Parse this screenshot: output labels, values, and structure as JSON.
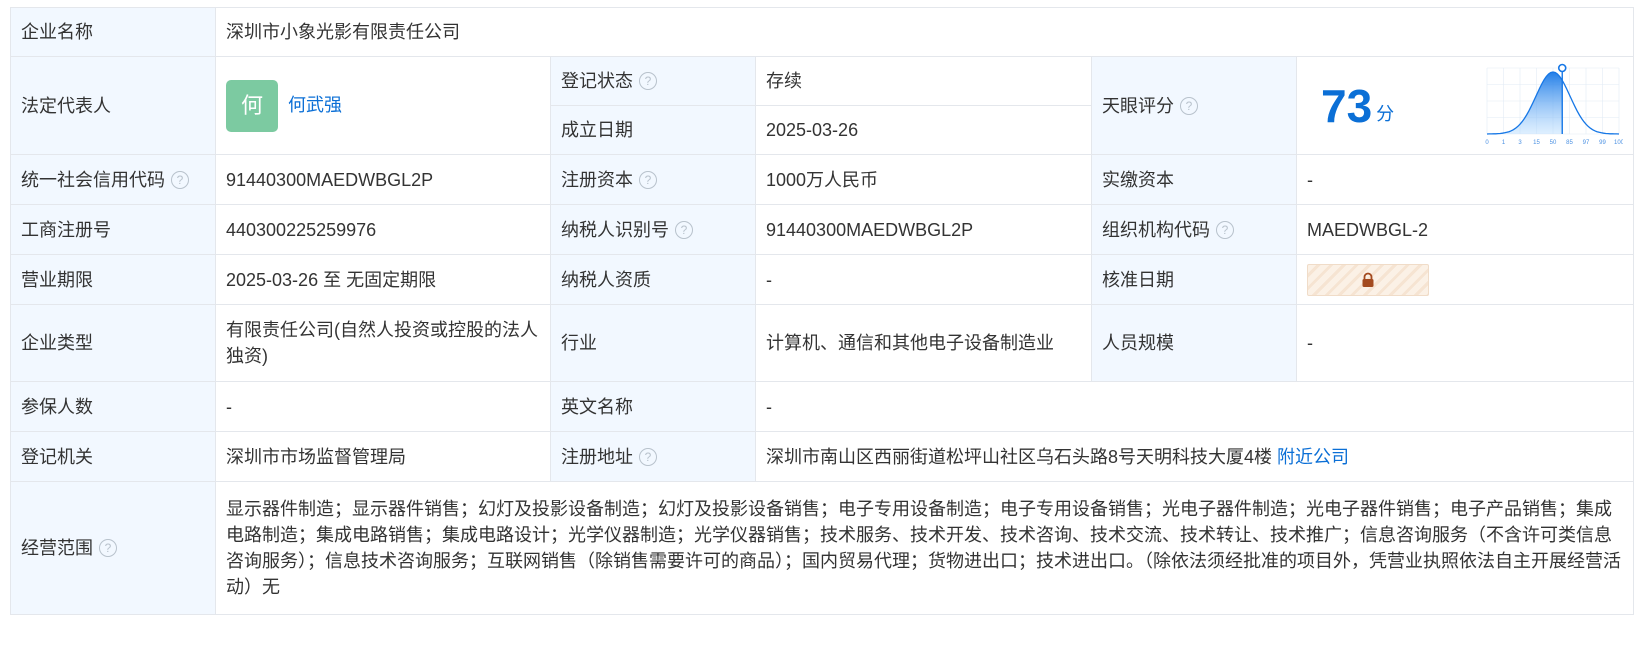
{
  "company_name": {
    "label": "企业名称",
    "value": "深圳市小象光影有限责任公司"
  },
  "legal_rep": {
    "label": "法定代表人",
    "avatar_char": "何",
    "name": "何武强"
  },
  "reg_status": {
    "label": "登记状态",
    "value": "存续"
  },
  "found_date": {
    "label": "成立日期",
    "value": "2025-03-26"
  },
  "tianyan": {
    "label": "天眼评分",
    "score": "73",
    "unit": "分",
    "ticks": [
      "0",
      "1",
      "3",
      "15",
      "50",
      "85",
      "97",
      "99",
      "100"
    ],
    "score_percentile": 0.57
  },
  "credit_code": {
    "label": "统一社会信用代码",
    "value": "91440300MAEDWBGL2P"
  },
  "reg_capital": {
    "label": "注册资本",
    "value": "1000万人民币"
  },
  "paid_capital": {
    "label": "实缴资本",
    "value": "-"
  },
  "biz_reg_no": {
    "label": "工商注册号",
    "value": "440300225259976"
  },
  "taxpayer_id": {
    "label": "纳税人识别号",
    "value": "91440300MAEDWBGL2P"
  },
  "org_code": {
    "label": "组织机构代码",
    "value": "MAEDWBGL-2"
  },
  "biz_term": {
    "label": "营业期限",
    "value": "2025-03-26 至 无固定期限"
  },
  "taxpayer_qual": {
    "label": "纳税人资质",
    "value": "-"
  },
  "approve_date": {
    "label": "核准日期"
  },
  "company_type": {
    "label": "企业类型",
    "value": "有限责任公司(自然人投资或控股的法人独资)"
  },
  "industry": {
    "label": "行业",
    "value": "计算机、通信和其他电子设备制造业"
  },
  "staff_size": {
    "label": "人员规模",
    "value": "-"
  },
  "insured": {
    "label": "参保人数",
    "value": "-"
  },
  "english_name": {
    "label": "英文名称",
    "value": "-"
  },
  "reg_authority": {
    "label": "登记机关",
    "value": "深圳市市场监督管理局"
  },
  "reg_address": {
    "label": "注册地址",
    "value": "深圳市南山区西丽街道松坪山社区乌石头路8号天明科技大厦4楼",
    "nearby": "附近公司"
  },
  "biz_scope": {
    "label": "经营范围",
    "value": "显示器件制造；显示器件销售；幻灯及投影设备制造；幻灯及投影设备销售；电子专用设备制造；电子专用设备销售；光电子器件制造；光电子器件销售；电子产品销售；集成电路制造；集成电路销售；集成电路设计；光学仪器制造；光学仪器销售；技术服务、技术开发、技术咨询、技术交流、技术转让、技术推广；信息咨询服务（不含许可类信息咨询服务）；信息技术咨询服务；互联网销售（除销售需要许可的商品）；国内贸易代理；货物进出口；技术进出口。（除依法须经批准的项目外，凭营业执照依法自主开展经营活动）无"
  },
  "help_icon_glyph": "?",
  "colors": {
    "label_bg": "#f2f8ff",
    "border": "#e4e7ec",
    "link": "#0b6fd6",
    "status_green": "#1f9d4c",
    "avatar_bg": "#7ccaa1"
  }
}
